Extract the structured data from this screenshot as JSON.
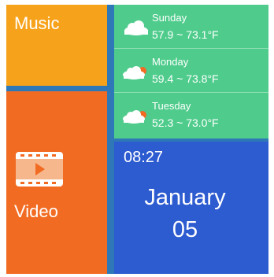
{
  "tiles": {
    "music": {
      "label": "Music",
      "color": "#f7a21b"
    },
    "video": {
      "label": "Video",
      "color": "#f26b22",
      "icon": "film-play-icon"
    }
  },
  "weather": {
    "color": "#4fcc8c",
    "days": [
      {
        "day": "Sunday",
        "temp": "57.9 ~ 73.1°F",
        "icon": "cloudy-icon"
      },
      {
        "day": "Monday",
        "temp": "59.4 ~ 73.8°F",
        "icon": "cloud-sun-icon"
      },
      {
        "day": "Tuesday",
        "temp": "52.3 ~ 73.0°F",
        "icon": "cloud-sun-icon"
      }
    ]
  },
  "clock": {
    "color": "#2d5bd0",
    "time": "08:27",
    "month": "January",
    "date": "05"
  },
  "accent": "#2f78b8"
}
